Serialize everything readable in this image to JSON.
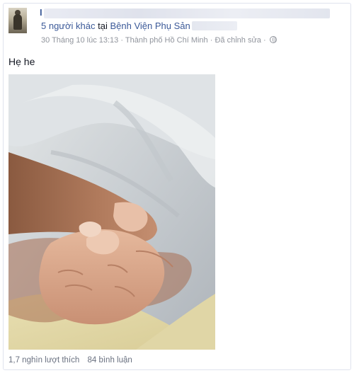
{
  "post": {
    "author_initial": "I",
    "tag_text": "5 người khác",
    "tag_connector": "tại",
    "place": "Bệnh Viện Phụ Sản",
    "timestamp": "30 Tháng 10 lúc 13:13",
    "location": "Thành phố Hồ Chí Minh",
    "edited_label": "Đã chỉnh sửa",
    "separator": "·",
    "privacy_icon": "globe-icon",
    "message": "Hẹ he",
    "photo_icon": "baby-hand-photo"
  },
  "stats": {
    "likes": "1,7 nghìn lượt thích",
    "comments": "84 bình luận"
  }
}
